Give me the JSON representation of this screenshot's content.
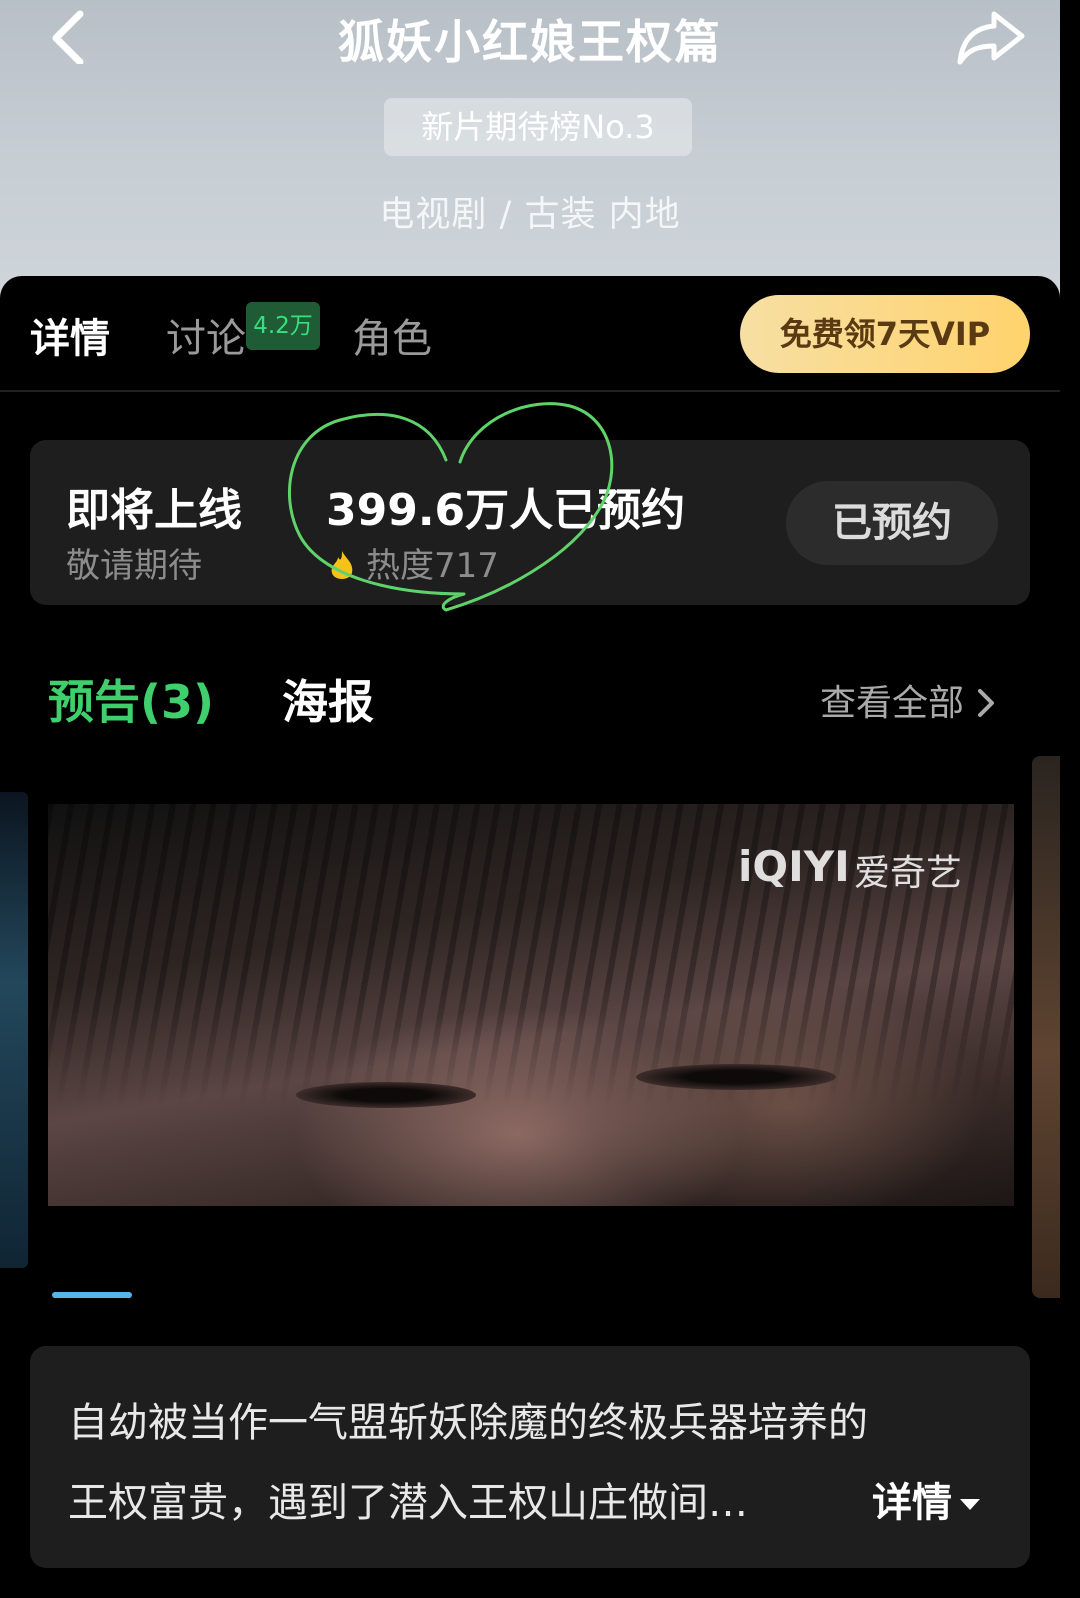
{
  "header": {
    "title": "狐妖小红娘王权篇",
    "rank_badge": "新片期待榜No.3",
    "genre": "电视剧 / 古装 内地"
  },
  "tabs": [
    {
      "label": "详情",
      "active": true
    },
    {
      "label": "讨论",
      "badge": "4.2万"
    },
    {
      "label": "角色"
    }
  ],
  "vip_button": "免费领7天VIP",
  "reservation": {
    "status": "即将上线",
    "sub": "敬请期待",
    "count": "399.6万人已预约",
    "heat": "热度717",
    "button": "已预约"
  },
  "media": {
    "trailers_tab": "预告(3)",
    "posters_tab": "海报",
    "view_all": "查看全部"
  },
  "video": {
    "watermark_logo": "iQIYI",
    "watermark_cn": "爱奇艺"
  },
  "synopsis": {
    "line1": "自幼被当作一气盟斩妖除魔的终极兵器培养的",
    "line2": "王权富贵，遇到了潜入王权山庄做间…",
    "more": "详情"
  },
  "colors": {
    "accent_green": "#3fd06d",
    "vip_gold": "#ffd36d",
    "heart_annotation": "#5fd36a"
  },
  "icons": [
    "back-arrow-icon",
    "share-icon",
    "flame-icon",
    "chevron-right-icon",
    "caret-down-icon"
  ]
}
